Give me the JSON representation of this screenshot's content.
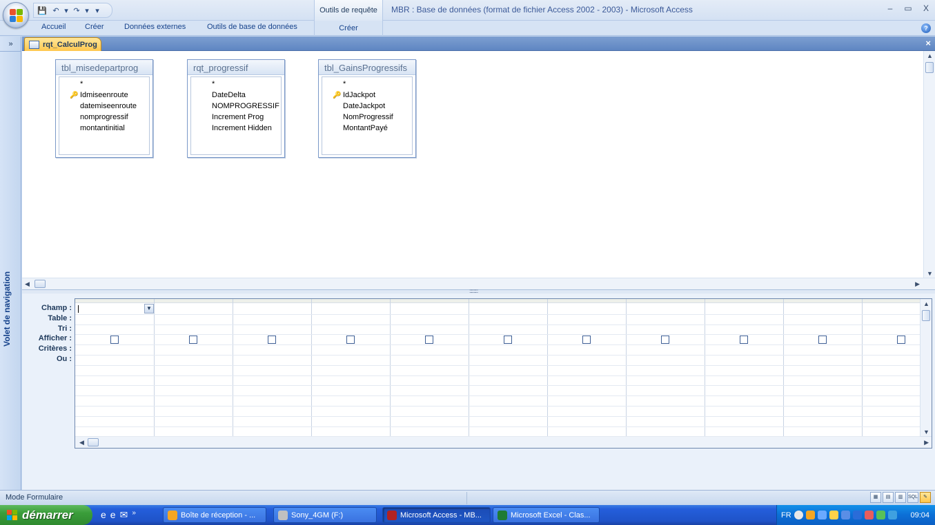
{
  "window": {
    "title": "MBR : Base de données (format de fichier Access 2002 - 2003) - Microsoft Access",
    "context_group": "Outils de requête",
    "controls": {
      "minimize": "–",
      "restore": "▭",
      "close": "X"
    }
  },
  "qat": {
    "save": "💾",
    "undo": "↶",
    "undo_drop": "▾",
    "redo": "↷",
    "redo_drop": "▾",
    "customize": "▾"
  },
  "ribbon": {
    "tabs": [
      "Accueil",
      "Créer",
      "Données externes",
      "Outils de base de données"
    ],
    "context_tab": "Créer",
    "help": "?"
  },
  "nav": {
    "toggle": "»",
    "label": "Volet de navigation"
  },
  "document": {
    "tab_label": "rqt_CalculProg",
    "close": "×"
  },
  "tables": [
    {
      "name": "tbl_misedepartprog",
      "fields": [
        {
          "name": "*",
          "key": false
        },
        {
          "name": "Idmiseenroute",
          "key": true
        },
        {
          "name": "datemiseenroute",
          "key": false
        },
        {
          "name": "nomprogressif",
          "key": false
        },
        {
          "name": "montantinitial",
          "key": false
        }
      ]
    },
    {
      "name": "rqt_progressif",
      "fields": [
        {
          "name": "*",
          "key": false
        },
        {
          "name": "DateDelta",
          "key": false
        },
        {
          "name": "NOMPROGRESSIF",
          "key": false
        },
        {
          "name": "Increment Prog",
          "key": false
        },
        {
          "name": "Increment Hidden",
          "key": false
        }
      ]
    },
    {
      "name": "tbl_GainsProgressifs",
      "fields": [
        {
          "name": "*",
          "key": false
        },
        {
          "name": "IdJackpot",
          "key": true
        },
        {
          "name": "DateJackpot",
          "key": false
        },
        {
          "name": "NomProgressif",
          "key": false
        },
        {
          "name": "MontantPayé",
          "key": false
        }
      ]
    }
  ],
  "grid": {
    "row_labels": [
      "Champ :",
      "Table :",
      "Tri :",
      "Afficher :",
      "Critères :",
      "Ou :"
    ],
    "column_count": 11,
    "show_checked": [
      false,
      false,
      false,
      false,
      false,
      false,
      false,
      false,
      false,
      false,
      false
    ],
    "field_value": ""
  },
  "status": {
    "mode": "Mode Formulaire",
    "view_buttons": [
      "▦",
      "▤",
      "▥",
      "SQL",
      "✎"
    ]
  },
  "taskbar": {
    "start_label": "démarrer",
    "quick_launch": [
      "e",
      "e",
      "✉",
      "»"
    ],
    "buttons": [
      {
        "label": "Boîte de réception - ...",
        "icon_color": "#f5a623",
        "active": false
      },
      {
        "label": "Sony_4GM (F:)",
        "icon_color": "#c0c0c0",
        "active": false
      },
      {
        "label": "Microsoft Access - MB...",
        "icon_color": "#b22222",
        "active": true
      },
      {
        "label": "Microsoft Excel - Clas...",
        "icon_color": "#1e7b34",
        "active": false
      }
    ],
    "tray": {
      "language": "FR",
      "clock": "09:04"
    }
  },
  "colors": {
    "accent": "#15428b",
    "doc_tab": "#ffc64a",
    "taskbar": "#245edb",
    "start": "#3a9d3a"
  }
}
